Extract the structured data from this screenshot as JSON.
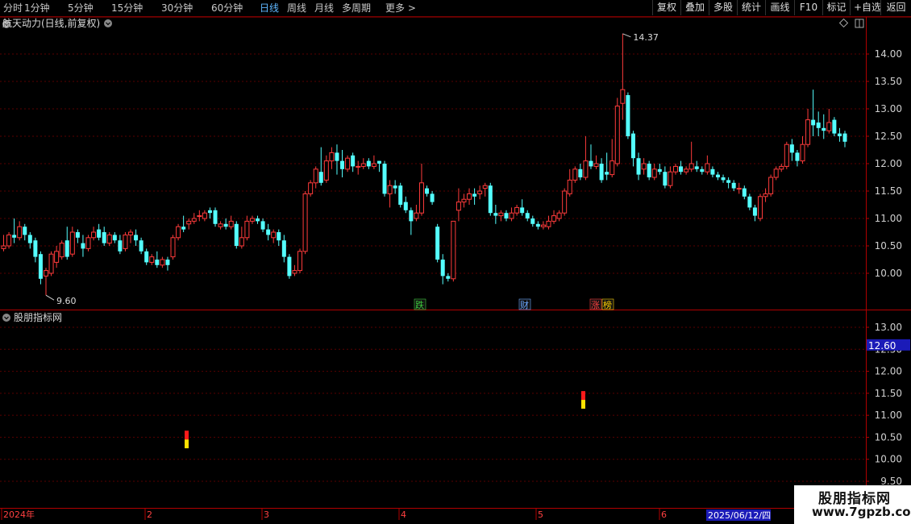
{
  "toolbar": {
    "periods": [
      {
        "label": "分时",
        "x": 4
      },
      {
        "label": "1分钟",
        "x": 30
      },
      {
        "label": "5分钟",
        "x": 84
      },
      {
        "label": "15分钟",
        "x": 138
      },
      {
        "label": "30分钟",
        "x": 200
      },
      {
        "label": "60分钟",
        "x": 262
      },
      {
        "label": "日线",
        "x": 322
      },
      {
        "label": "周线",
        "x": 356
      },
      {
        "label": "月线",
        "x": 390
      },
      {
        "label": "多周期",
        "x": 424
      },
      {
        "label": "更多 >",
        "x": 478
      }
    ],
    "active_period": "日线",
    "buttons": [
      "复权",
      "叠加",
      "多股",
      "统计",
      "画线",
      "F10",
      "标记",
      "+自选",
      "返回"
    ]
  },
  "main_panel": {
    "title": "航天动力(日线,前复权)",
    "y_ticks": [
      "14.00",
      "13.50",
      "13.00",
      "12.50",
      "12.00",
      "11.50",
      "11.00",
      "10.50",
      "10.00"
    ],
    "high_label": "14.37",
    "low_label": "9.60",
    "event_tags": [
      {
        "text": "跌",
        "color": "#3dcc3d"
      },
      {
        "text": "财",
        "color": "#6aa7ff"
      },
      {
        "text": "涨",
        "color": "#ff4040"
      },
      {
        "text": "榜",
        "color": "#ffd200"
      }
    ]
  },
  "indicator_panel": {
    "title": "股朋指标网",
    "y_ticks": [
      "13.00",
      "12.50",
      "12.00",
      "11.50",
      "11.00",
      "10.50",
      "10.00",
      "9.50"
    ],
    "current_value": "12.60",
    "signals": [
      {
        "date_index": 56,
        "top": 10.65,
        "mid": 10.45,
        "bottom": 10.25
      },
      {
        "date_index": 178,
        "top": 11.55,
        "mid": 11.35,
        "bottom": 11.15
      }
    ]
  },
  "date_axis": {
    "labels": [
      "2024年",
      "2",
      "3",
      "4",
      "5",
      "6"
    ],
    "cursor_date": "2025/06/12/四"
  },
  "watermark": {
    "line1": "股朋指标网",
    "line2": "www.7gpzb.com"
  },
  "colors": {
    "up": "#ff3b3b",
    "down": "#54ffff",
    "grid": "#5a0000",
    "frame": "#b00000",
    "axis_text": "#d0d0d0",
    "active": "#5fb7ff"
  },
  "chart_data": {
    "type": "candlestick",
    "title": "航天动力(日线,前复权)",
    "candles": [
      [
        10.45,
        10.5,
        10.4,
        10.7
      ],
      [
        10.5,
        10.7,
        10.45,
        10.75
      ],
      [
        10.7,
        10.65,
        10.55,
        11.0
      ],
      [
        10.65,
        10.85,
        10.6,
        10.95
      ],
      [
        10.85,
        10.7,
        10.6,
        10.9
      ],
      [
        10.7,
        10.55,
        10.45,
        10.75
      ],
      [
        10.6,
        10.3,
        10.2,
        10.65
      ],
      [
        10.35,
        9.9,
        9.8,
        10.4
      ],
      [
        9.95,
        10.05,
        9.6,
        10.1
      ],
      [
        10.0,
        10.35,
        9.95,
        10.4
      ],
      [
        10.2,
        10.4,
        10.1,
        10.5
      ],
      [
        10.3,
        10.55,
        10.25,
        10.6
      ],
      [
        10.6,
        10.3,
        10.25,
        10.85
      ],
      [
        10.35,
        10.75,
        10.3,
        10.85
      ],
      [
        10.75,
        10.65,
        10.55,
        10.8
      ],
      [
        10.55,
        10.45,
        10.3,
        10.7
      ],
      [
        10.45,
        10.65,
        10.4,
        10.7
      ],
      [
        10.65,
        10.75,
        10.6,
        10.85
      ],
      [
        10.8,
        10.65,
        10.6,
        10.9
      ],
      [
        10.75,
        10.55,
        10.5,
        10.85
      ],
      [
        10.55,
        10.7,
        10.5,
        10.75
      ],
      [
        10.7,
        10.6,
        10.55,
        10.75
      ],
      [
        10.6,
        10.4,
        10.35,
        10.7
      ],
      [
        10.45,
        10.7,
        10.4,
        10.75
      ],
      [
        10.7,
        10.75,
        10.55,
        10.8
      ],
      [
        10.7,
        10.6,
        10.5,
        10.8
      ],
      [
        10.6,
        10.4,
        10.35,
        10.65
      ],
      [
        10.4,
        10.2,
        10.15,
        10.45
      ],
      [
        10.2,
        10.3,
        10.15,
        10.35
      ],
      [
        10.25,
        10.15,
        10.1,
        10.4
      ],
      [
        10.15,
        10.25,
        10.1,
        10.3
      ],
      [
        10.25,
        10.15,
        10.05,
        10.3
      ],
      [
        10.3,
        10.65,
        10.25,
        10.7
      ],
      [
        10.65,
        10.85,
        10.6,
        10.9
      ],
      [
        10.85,
        10.8,
        10.75,
        11.05
      ],
      [
        10.9,
        10.95,
        10.8,
        11.0
      ],
      [
        10.95,
        11.0,
        10.9,
        11.1
      ],
      [
        11.05,
        11.05,
        10.95,
        11.15
      ],
      [
        11.0,
        11.1,
        10.95,
        11.15
      ],
      [
        11.15,
        11.1,
        11.0,
        11.2
      ],
      [
        11.15,
        10.9,
        10.85,
        11.2
      ],
      [
        10.85,
        10.9,
        10.8,
        10.95
      ],
      [
        10.9,
        10.85,
        10.8,
        11.0
      ],
      [
        10.85,
        10.95,
        10.8,
        11.05
      ],
      [
        10.9,
        10.5,
        10.45,
        10.95
      ],
      [
        10.5,
        10.65,
        10.45,
        10.85
      ],
      [
        10.65,
        10.95,
        10.6,
        11.05
      ],
      [
        10.95,
        11.0,
        10.9,
        11.05
      ],
      [
        11.0,
        10.95,
        10.9,
        11.05
      ],
      [
        10.95,
        10.8,
        10.75,
        11.0
      ],
      [
        10.8,
        10.7,
        10.6,
        10.9
      ],
      [
        10.65,
        10.75,
        10.55,
        10.8
      ],
      [
        10.75,
        10.6,
        10.5,
        10.8
      ],
      [
        10.6,
        10.3,
        10.2,
        10.7
      ],
      [
        10.3,
        9.95,
        9.9,
        10.35
      ],
      [
        10.0,
        10.05,
        9.95,
        10.15
      ],
      [
        10.05,
        10.4,
        10.0,
        10.45
      ],
      [
        10.4,
        11.45,
        10.35,
        11.5
      ],
      [
        11.45,
        11.65,
        11.4,
        11.7
      ],
      [
        11.65,
        11.9,
        11.55,
        11.95
      ],
      [
        11.85,
        11.65,
        11.6,
        12.3
      ],
      [
        11.7,
        12.05,
        11.65,
        12.15
      ],
      [
        12.05,
        12.2,
        11.9,
        12.3
      ],
      [
        12.2,
        12.05,
        11.8,
        12.35
      ],
      [
        12.05,
        11.9,
        11.75,
        12.25
      ],
      [
        11.9,
        12.1,
        11.85,
        12.15
      ],
      [
        12.15,
        11.95,
        11.85,
        12.2
      ],
      [
        11.95,
        11.95,
        11.8,
        12.05
      ],
      [
        11.95,
        12.0,
        11.9,
        12.1
      ],
      [
        12.05,
        11.95,
        11.9,
        12.1
      ],
      [
        11.95,
        12.0,
        11.9,
        12.15
      ],
      [
        12.05,
        12.0,
        11.85,
        12.05
      ],
      [
        12.0,
        11.45,
        11.4,
        12.05
      ],
      [
        11.45,
        11.6,
        11.2,
        11.7
      ],
      [
        11.6,
        11.55,
        11.45,
        11.7
      ],
      [
        11.6,
        11.25,
        11.2,
        11.65
      ],
      [
        11.3,
        11.15,
        11.1,
        11.4
      ],
      [
        11.15,
        10.95,
        10.7,
        11.2
      ],
      [
        11.0,
        11.1,
        10.95,
        11.25
      ],
      [
        11.1,
        11.65,
        11.05,
        12.0
      ],
      [
        11.55,
        11.45,
        11.4,
        11.6
      ],
      [
        11.45,
        11.3,
        11.25,
        11.5
      ],
      [
        10.85,
        10.25,
        10.2,
        10.9
      ],
      [
        10.25,
        9.95,
        9.8,
        10.35
      ],
      [
        9.95,
        9.9,
        9.85,
        10.0
      ],
      [
        9.9,
        10.95,
        9.85,
        10.95
      ],
      [
        11.15,
        11.3,
        10.95,
        11.55
      ],
      [
        11.3,
        11.35,
        11.2,
        11.45
      ],
      [
        11.35,
        11.45,
        11.25,
        11.55
      ],
      [
        11.45,
        11.4,
        11.25,
        11.55
      ],
      [
        11.45,
        11.5,
        11.35,
        11.6
      ],
      [
        11.55,
        11.6,
        11.4,
        11.65
      ],
      [
        11.6,
        11.1,
        11.05,
        11.65
      ],
      [
        11.1,
        11.05,
        10.9,
        11.25
      ],
      [
        11.05,
        11.1,
        10.95,
        11.15
      ],
      [
        11.1,
        11.0,
        10.95,
        11.15
      ],
      [
        11.0,
        11.1,
        10.95,
        11.2
      ],
      [
        11.1,
        11.2,
        11.05,
        11.25
      ],
      [
        11.2,
        11.1,
        11.05,
        11.35
      ],
      [
        11.1,
        11.0,
        10.95,
        11.15
      ],
      [
        11.0,
        10.9,
        10.85,
        11.05
      ],
      [
        10.9,
        10.85,
        10.8,
        10.95
      ],
      [
        10.85,
        10.88,
        10.8,
        10.95
      ],
      [
        10.85,
        10.95,
        10.8,
        11.05
      ],
      [
        10.95,
        11.05,
        10.9,
        11.15
      ],
      [
        11.0,
        11.1,
        10.95,
        11.15
      ],
      [
        11.1,
        11.5,
        11.05,
        11.55
      ],
      [
        11.45,
        11.7,
        11.4,
        11.9
      ],
      [
        11.7,
        11.9,
        11.65,
        11.95
      ],
      [
        11.9,
        11.75,
        11.7,
        12.0
      ],
      [
        11.75,
        12.05,
        11.7,
        12.5
      ],
      [
        12.05,
        11.95,
        11.9,
        12.35
      ],
      [
        11.95,
        12.0,
        11.9,
        12.15
      ],
      [
        12.0,
        11.7,
        11.65,
        12.1
      ],
      [
        11.85,
        11.8,
        11.7,
        12.2
      ],
      [
        11.8,
        12.05,
        11.75,
        12.45
      ],
      [
        12.0,
        13.05,
        11.95,
        13.2
      ],
      [
        13.1,
        13.35,
        12.8,
        14.37
      ],
      [
        13.25,
        12.5,
        12.45,
        13.3
      ],
      [
        12.55,
        12.1,
        11.95,
        12.6
      ],
      [
        12.1,
        11.8,
        11.7,
        12.2
      ],
      [
        11.9,
        12.0,
        11.8,
        12.1
      ],
      [
        12.0,
        11.75,
        11.7,
        12.05
      ],
      [
        11.75,
        11.9,
        11.7,
        12.0
      ],
      [
        11.9,
        11.85,
        11.8,
        12.0
      ],
      [
        11.85,
        11.6,
        11.55,
        11.95
      ],
      [
        11.6,
        11.85,
        11.55,
        11.95
      ],
      [
        11.85,
        11.95,
        11.8,
        12.0
      ],
      [
        11.95,
        11.85,
        11.8,
        12.05
      ],
      [
        11.85,
        11.9,
        11.8,
        11.95
      ],
      [
        11.9,
        12.0,
        11.85,
        12.4
      ],
      [
        11.95,
        11.9,
        11.85,
        12.05
      ],
      [
        11.9,
        11.85,
        11.8,
        11.95
      ],
      [
        11.85,
        12.0,
        11.8,
        12.15
      ],
      [
        11.9,
        11.8,
        11.75,
        11.95
      ],
      [
        11.8,
        11.75,
        11.7,
        11.85
      ],
      [
        11.75,
        11.7,
        11.65,
        11.8
      ],
      [
        11.7,
        11.65,
        11.55,
        11.75
      ],
      [
        11.65,
        11.55,
        11.5,
        11.7
      ],
      [
        11.55,
        11.55,
        11.45,
        11.65
      ],
      [
        11.55,
        11.4,
        11.35,
        11.6
      ],
      [
        11.4,
        11.2,
        11.15,
        11.45
      ],
      [
        11.2,
        11.05,
        10.95,
        11.25
      ],
      [
        11.0,
        11.4,
        10.95,
        11.45
      ],
      [
        11.4,
        11.45,
        11.3,
        11.55
      ],
      [
        11.45,
        11.75,
        11.4,
        11.8
      ],
      [
        11.75,
        11.9,
        11.7,
        11.95
      ],
      [
        11.9,
        11.95,
        11.85,
        12.0
      ],
      [
        11.95,
        12.35,
        11.9,
        12.4
      ],
      [
        12.35,
        12.2,
        12.05,
        12.45
      ],
      [
        12.2,
        12.05,
        11.95,
        12.25
      ],
      [
        12.05,
        12.35,
        12.0,
        12.5
      ],
      [
        12.35,
        12.8,
        12.3,
        13.0
      ],
      [
        12.8,
        12.7,
        12.5,
        13.35
      ],
      [
        12.75,
        12.65,
        12.5,
        12.95
      ],
      [
        12.65,
        12.6,
        12.45,
        12.9
      ],
      [
        12.6,
        12.75,
        12.55,
        13.0
      ],
      [
        12.8,
        12.55,
        12.5,
        12.85
      ],
      [
        12.55,
        12.5,
        12.4,
        12.65
      ],
      [
        12.55,
        12.4,
        12.3,
        12.6
      ]
    ],
    "indicator_ylim": [
      9.5,
      13.0
    ],
    "price_ylim": [
      9.5,
      14.5
    ]
  }
}
